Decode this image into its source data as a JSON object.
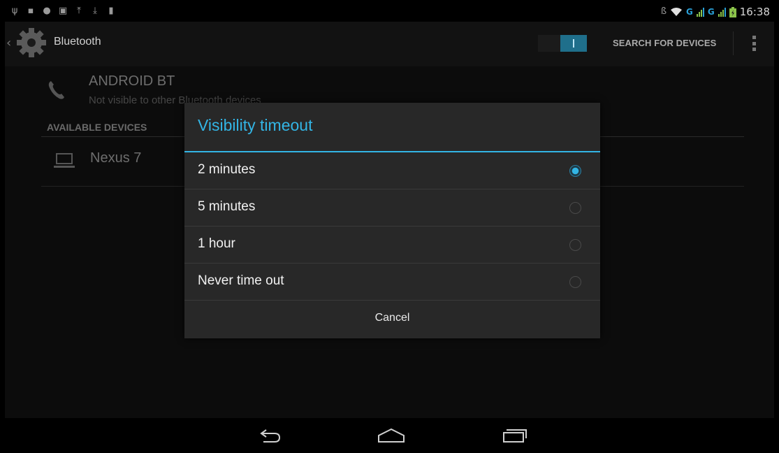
{
  "status_bar": {
    "time": "16:38",
    "network_type_1": "G",
    "network_type_2": "G"
  },
  "action_bar": {
    "title": "Bluetooth",
    "search_label": "SEARCH FOR DEVICES",
    "bluetooth_enabled": true
  },
  "content": {
    "local_device_name": "ANDROID BT",
    "local_device_status": "Not visible to other Bluetooth devices",
    "available_header": "AVAILABLE DEVICES",
    "available_devices": [
      "Nexus 7"
    ]
  },
  "dialog": {
    "title": "Visibility timeout",
    "options": [
      "2 minutes",
      "5 minutes",
      "1 hour",
      "Never time out"
    ],
    "selected_index": 0,
    "cancel_label": "Cancel"
  },
  "colors": {
    "accent": "#33b5e5",
    "dialog_bg": "#282828"
  }
}
